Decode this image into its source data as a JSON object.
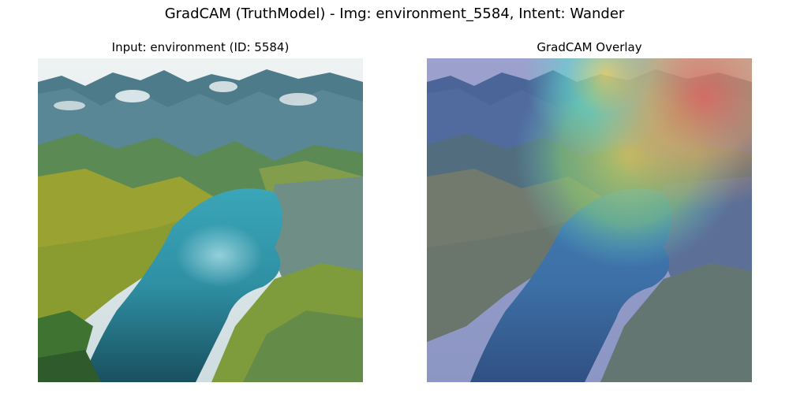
{
  "figure": {
    "suptitle": "GradCAM (TruthModel) - Img: environment_5584, Intent: Wander"
  },
  "panels": [
    {
      "title": "Input: environment (ID: 5584)"
    },
    {
      "title": "GradCAM Overlay"
    }
  ],
  "image": {
    "description_colors": {
      "sky": "#e4eaec",
      "mountain_rock": "#4f7d8a",
      "meadow_yellow": "#a9a828",
      "forest_green": "#3f7331",
      "lake_teal": "#2f93a6",
      "lake_deep": "#1c5a6c",
      "overlay_base_blue": "#5a6aa8",
      "heat_red": "#e07a6e",
      "heat_yellow": "#e8e25a",
      "heat_green": "#7fd07a",
      "heat_cyan": "#5ad0e0"
    }
  }
}
